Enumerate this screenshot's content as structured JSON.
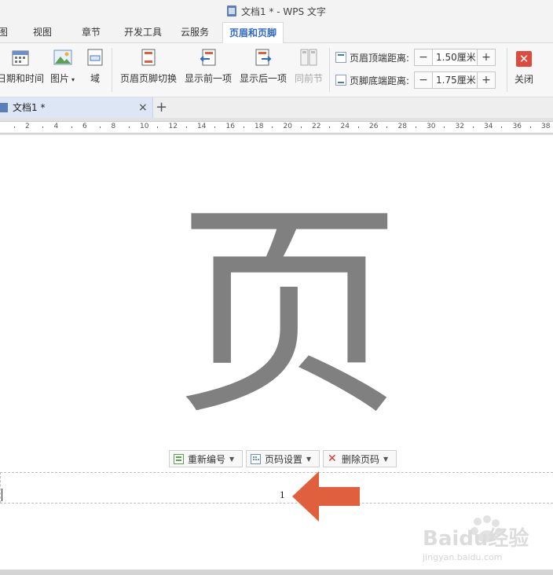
{
  "window": {
    "title": "文档1 * - WPS 文字"
  },
  "menu": {
    "items": [
      {
        "label": "图"
      },
      {
        "label": "视图"
      },
      {
        "label": "章节"
      },
      {
        "label": "开发工具"
      },
      {
        "label": "云服务"
      },
      {
        "label": "页眉和页脚",
        "active": true
      }
    ]
  },
  "ribbon": {
    "date_time": "日期和时间",
    "picture": "图片",
    "field": "域",
    "switch_header_footer": "页眉页脚切换",
    "show_previous": "显示前一项",
    "show_next": "显示后一项",
    "same_as_previous": "同前节",
    "header_top_distance_label": "页眉顶端距离:",
    "header_top_distance_value": "1.50厘米",
    "footer_bottom_distance_label": "页脚底端距离:",
    "footer_bottom_distance_value": "1.75厘米",
    "close": "关闭"
  },
  "tabs": [
    {
      "label": "文档1 *"
    }
  ],
  "ruler": {
    "labels": [
      "2",
      "4",
      "6",
      "8",
      "10",
      "12",
      "14",
      "16",
      "18",
      "20",
      "22",
      "24",
      "26",
      "28",
      "30",
      "32",
      "34",
      "36",
      "38"
    ]
  },
  "document": {
    "big_character": "页",
    "footer_toolbar": {
      "renumber": "重新编号",
      "page_number_settings": "页码设置",
      "delete_page_number": "删除页码"
    },
    "page_number": "1"
  },
  "watermark": {
    "brand": "Baidu经验",
    "url": "jingyan.baidu.com"
  },
  "colors": {
    "accent": "#2f69c4",
    "arrow": "#e0603e",
    "close": "#e04a3d",
    "glyph": "#808080"
  }
}
